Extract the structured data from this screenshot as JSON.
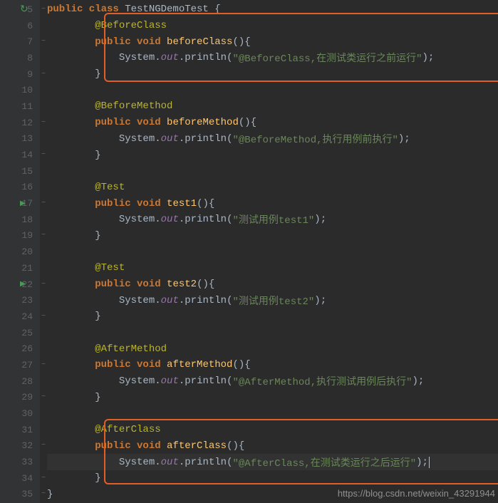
{
  "lines": [
    {
      "num": 5,
      "reload": true,
      "fold": "⊖",
      "indent": 0,
      "tokens": [
        [
          "kw",
          "public class "
        ],
        [
          "class-name",
          "TestNGDemoTest "
        ],
        [
          "punct",
          "{"
        ]
      ]
    },
    {
      "num": 6,
      "indent": 2,
      "tokens": [
        [
          "anno",
          "@BeforeClass"
        ]
      ]
    },
    {
      "num": 7,
      "fold": "⊖",
      "indent": 2,
      "tokens": [
        [
          "kw",
          "public void "
        ],
        [
          "method",
          "beforeClass"
        ],
        [
          "punct",
          "(){"
        ]
      ]
    },
    {
      "num": 8,
      "indent": 3,
      "tokens": [
        [
          "class-name",
          "System."
        ],
        [
          "static-field",
          "out"
        ],
        [
          "punct",
          ".println("
        ],
        [
          "str",
          "\"@BeforeClass,在测试类运行之前运行\""
        ],
        [
          "punct",
          ");"
        ]
      ]
    },
    {
      "num": 9,
      "fold": "⊖",
      "indent": 2,
      "tokens": [
        [
          "punct",
          "}"
        ]
      ]
    },
    {
      "num": 10,
      "indent": 0,
      "tokens": []
    },
    {
      "num": 11,
      "indent": 2,
      "tokens": [
        [
          "anno",
          "@BeforeMethod"
        ]
      ]
    },
    {
      "num": 12,
      "fold": "⊖",
      "indent": 2,
      "tokens": [
        [
          "kw",
          "public void "
        ],
        [
          "method",
          "beforeMethod"
        ],
        [
          "punct",
          "(){"
        ]
      ]
    },
    {
      "num": 13,
      "indent": 3,
      "tokens": [
        [
          "class-name",
          "System."
        ],
        [
          "static-field",
          "out"
        ],
        [
          "punct",
          ".println("
        ],
        [
          "str",
          "\"@BeforeMethod,执行用例前执行\""
        ],
        [
          "punct",
          ");"
        ]
      ]
    },
    {
      "num": 14,
      "fold": "⊖",
      "indent": 2,
      "tokens": [
        [
          "punct",
          "}"
        ]
      ]
    },
    {
      "num": 15,
      "indent": 0,
      "tokens": []
    },
    {
      "num": 16,
      "indent": 2,
      "tokens": [
        [
          "anno",
          "@Test"
        ]
      ]
    },
    {
      "num": 17,
      "run": true,
      "fold": "⊖",
      "indent": 2,
      "tokens": [
        [
          "kw",
          "public void "
        ],
        [
          "method",
          "test1"
        ],
        [
          "punct",
          "(){"
        ]
      ]
    },
    {
      "num": 18,
      "indent": 3,
      "tokens": [
        [
          "class-name",
          "System."
        ],
        [
          "static-field",
          "out"
        ],
        [
          "punct",
          ".println("
        ],
        [
          "str",
          "\"测试用例test1\""
        ],
        [
          "punct",
          ");"
        ]
      ]
    },
    {
      "num": 19,
      "fold": "⊖",
      "indent": 2,
      "tokens": [
        [
          "punct",
          "}"
        ]
      ]
    },
    {
      "num": 20,
      "indent": 0,
      "tokens": []
    },
    {
      "num": 21,
      "indent": 2,
      "tokens": [
        [
          "anno",
          "@Test"
        ]
      ]
    },
    {
      "num": 22,
      "run": true,
      "fold": "⊖",
      "indent": 2,
      "tokens": [
        [
          "kw",
          "public void "
        ],
        [
          "method",
          "test2"
        ],
        [
          "punct",
          "(){"
        ]
      ]
    },
    {
      "num": 23,
      "indent": 3,
      "tokens": [
        [
          "class-name",
          "System."
        ],
        [
          "static-field",
          "out"
        ],
        [
          "punct",
          ".println("
        ],
        [
          "str",
          "\"测试用例test2\""
        ],
        [
          "punct",
          ");"
        ]
      ]
    },
    {
      "num": 24,
      "fold": "⊖",
      "indent": 2,
      "tokens": [
        [
          "punct",
          "}"
        ]
      ]
    },
    {
      "num": 25,
      "indent": 0,
      "tokens": []
    },
    {
      "num": 26,
      "indent": 2,
      "tokens": [
        [
          "anno",
          "@AfterMethod"
        ]
      ]
    },
    {
      "num": 27,
      "fold": "⊖",
      "indent": 2,
      "tokens": [
        [
          "kw",
          "public void "
        ],
        [
          "method",
          "afterMethod"
        ],
        [
          "punct",
          "(){"
        ]
      ]
    },
    {
      "num": 28,
      "indent": 3,
      "tokens": [
        [
          "class-name",
          "System."
        ],
        [
          "static-field",
          "out"
        ],
        [
          "punct",
          ".println("
        ],
        [
          "str",
          "\"@AfterMethod,执行测试用例后执行\""
        ],
        [
          "punct",
          ");"
        ]
      ]
    },
    {
      "num": 29,
      "fold": "⊖",
      "indent": 2,
      "tokens": [
        [
          "punct",
          "}"
        ]
      ]
    },
    {
      "num": 30,
      "indent": 0,
      "tokens": []
    },
    {
      "num": 31,
      "indent": 2,
      "tokens": [
        [
          "anno",
          "@AfterClass"
        ]
      ]
    },
    {
      "num": 32,
      "fold": "⊖",
      "indent": 2,
      "tokens": [
        [
          "kw",
          "public void "
        ],
        [
          "method",
          "afterClass"
        ],
        [
          "punct",
          "(){"
        ]
      ]
    },
    {
      "num": 33,
      "caret": true,
      "indent": 3,
      "tokens": [
        [
          "class-name",
          "System."
        ],
        [
          "static-field",
          "out"
        ],
        [
          "punct",
          ".println("
        ],
        [
          "str",
          "\"@AfterClass,在测试类运行之后运行\""
        ],
        [
          "punct",
          ");"
        ]
      ]
    },
    {
      "num": 34,
      "fold": "⊖",
      "indent": 2,
      "tokens": [
        [
          "punct",
          "}"
        ]
      ]
    },
    {
      "num": 35,
      "fold": "⊖",
      "indent": 0,
      "tokens": [
        [
          "punct",
          "}"
        ]
      ]
    }
  ],
  "watermark": "https://blog.csdn.net/weixin_43291944"
}
